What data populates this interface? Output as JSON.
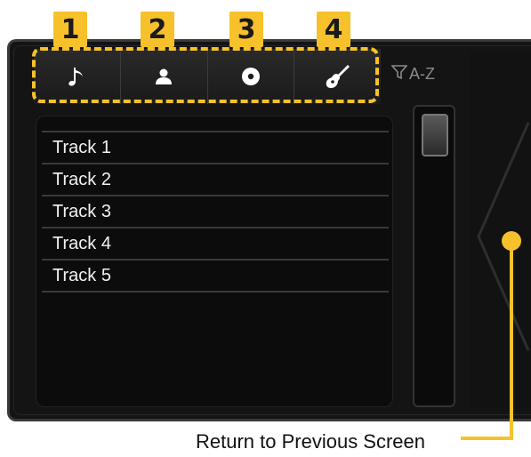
{
  "tabs": [
    {
      "badge": "1",
      "icon": "music-note-icon"
    },
    {
      "badge": "2",
      "icon": "person-icon"
    },
    {
      "badge": "3",
      "icon": "disc-icon"
    },
    {
      "badge": "4",
      "icon": "guitar-icon"
    }
  ],
  "sort": {
    "label": "A-Z"
  },
  "tracks": [
    "Track 1",
    "Track 2",
    "Track 3",
    "Track 4",
    "Track 5"
  ],
  "callout": {
    "text": "Return to Previous Screen"
  },
  "colors": {
    "accent": "#f6c12a",
    "panel": "#141414",
    "text": "#f2f2f2"
  }
}
